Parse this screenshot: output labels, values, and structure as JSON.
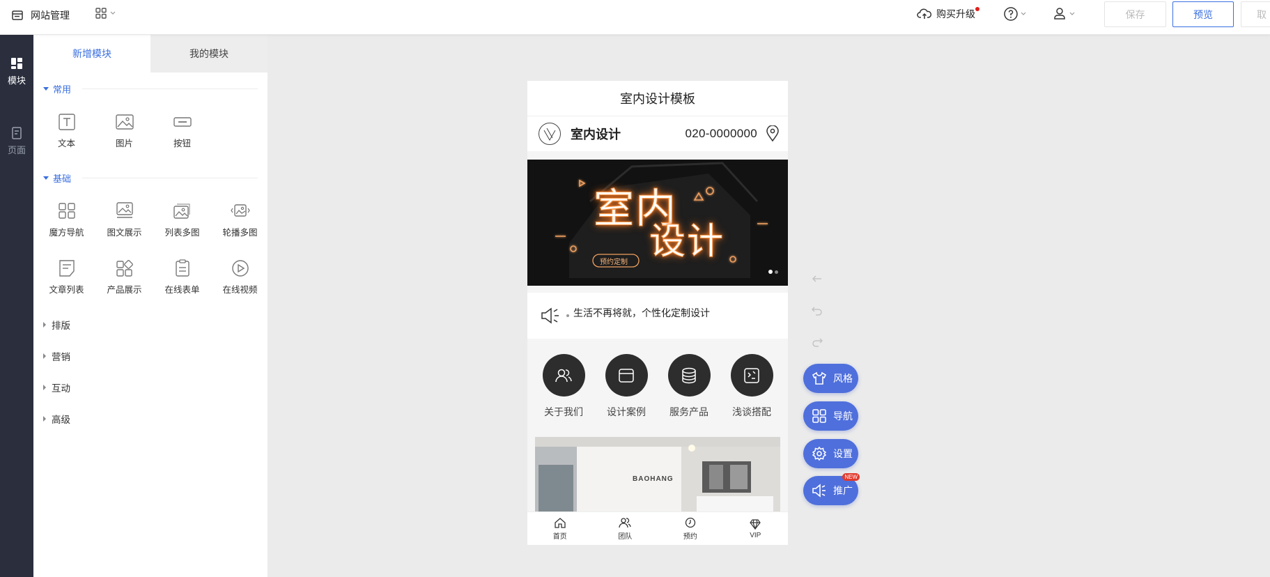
{
  "topbar": {
    "site_label": "网站管理",
    "upgrade_label": "购买升级",
    "save_label": "保存",
    "preview_label": "预览",
    "cancel_label": "取"
  },
  "rail": {
    "items": [
      {
        "label": "模块",
        "active": true
      },
      {
        "label": "页面",
        "active": false
      }
    ]
  },
  "panel": {
    "tabs": [
      {
        "label": "新增模块",
        "active": true
      },
      {
        "label": "我的模块",
        "active": false
      }
    ],
    "sections": [
      {
        "title": "常用",
        "modules": [
          "文本",
          "图片",
          "按钮"
        ]
      },
      {
        "title": "基础",
        "modules": [
          "魔方导航",
          "图文展示",
          "列表多图",
          "轮播多图",
          "文章列表",
          "产品展示",
          "在线表单",
          "在线视频"
        ]
      }
    ],
    "collapsed": [
      "排版",
      "营销",
      "互动",
      "高级"
    ]
  },
  "phone": {
    "title": "室内设计模板",
    "brand": "室内设计",
    "phone_number": "020-0000000",
    "banner": {
      "text_top": "室内",
      "text_bottom": "设计",
      "button": "预约定制"
    },
    "notice": "生活不再将就，个性化定制设计",
    "nav": [
      "关于我们",
      "设计案例",
      "服务产品",
      "浅谈搭配"
    ],
    "photo_sign": "BAOHANG",
    "tabbar": [
      "首页",
      "团队",
      "预约",
      "VIP"
    ]
  },
  "fabs": [
    {
      "label": "风格",
      "icon": "shirt-icon"
    },
    {
      "label": "导航",
      "icon": "grid-icon"
    },
    {
      "label": "设置",
      "icon": "gear-icon"
    },
    {
      "label": "推广",
      "icon": "megaphone-icon",
      "badge": "NEW"
    }
  ],
  "colors": {
    "accent": "#3a6fe0",
    "fab": "#4f6fdc",
    "rail": "#2a2e3d",
    "badge": "#e23a2e"
  }
}
